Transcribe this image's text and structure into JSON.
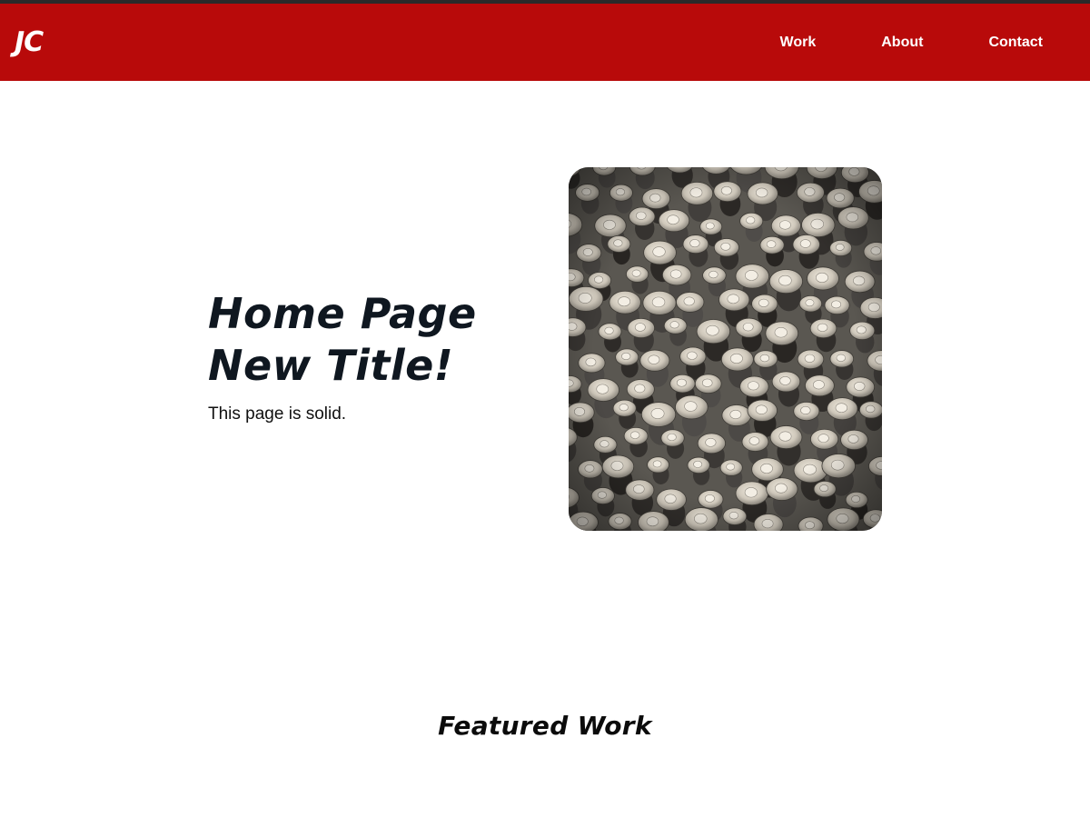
{
  "header": {
    "logo": "JC",
    "nav": {
      "work": "Work",
      "about": "About",
      "contact": "Contact"
    }
  },
  "hero": {
    "title_line1": "Home Page",
    "title_line2": "New Title!",
    "subtitle": "This page is solid.",
    "image_description_icon": "crowd-photo"
  },
  "featured": {
    "title": "Featured Work"
  },
  "colors": {
    "brand_red": "#b80a0a",
    "top_strip": "#2a2a2a",
    "heading": "#0f1720",
    "background": "#ffffff"
  }
}
